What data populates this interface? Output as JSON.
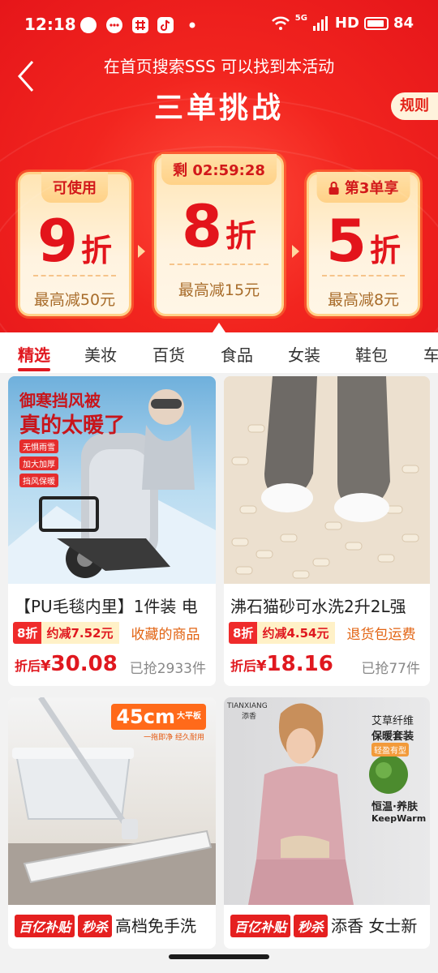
{
  "status": {
    "time": "12:18",
    "network": "5G",
    "hd": "HD",
    "battery": "84"
  },
  "header": {
    "search_hint": "在首页搜索SSS 可以找到本活动",
    "title": "三单挑战",
    "rules_label": "规则"
  },
  "cards": [
    {
      "tag": "可使用",
      "discount": "9",
      "unit": "折",
      "max": "最高减50元"
    },
    {
      "tag": "剩 02:59:28",
      "discount": "8",
      "unit": "折",
      "max": "最高减15元"
    },
    {
      "tag": "第3单享",
      "discount": "5",
      "unit": "折",
      "max": "最高减8元"
    }
  ],
  "tabs": [
    "精选",
    "美妆",
    "百货",
    "食品",
    "女装",
    "鞋包",
    "车"
  ],
  "products": [
    {
      "image_text": {
        "line1": "御寒挡风被",
        "line2": "真的太暖了",
        "chips": [
          "无惧雨雪",
          "加大加厚",
          "挡风保暖"
        ]
      },
      "title": "【PU毛毯内里】1件装 电",
      "badge_discount": "8折",
      "badge_save": "约减7.52元",
      "note": "收藏的商品",
      "price_label": "折后",
      "currency": "¥",
      "price": "30.08",
      "sold": "已抢2933件"
    },
    {
      "title": "沸石猫砂可水洗2升2L强",
      "badge_discount": "8折",
      "badge_save": "约减4.54元",
      "note": "退货包运费",
      "price_label": "折后",
      "currency": "¥",
      "price": "18.16",
      "sold": "已抢77件"
    },
    {
      "image_text": {
        "size": "45cm",
        "size_sub": "大平板",
        "caption": "一拖即净 经久耐用"
      },
      "promo1": "百亿补贴",
      "promo2": "秒杀",
      "title": "高档免手洗"
    },
    {
      "image_text": {
        "brand": "TIANXIANG",
        "brand_cn": "添香",
        "line1": "艾草纤维",
        "line2": "保暖套装",
        "line3": "轻盈有型",
        "line4": "恒温·养肤",
        "line5": "KeepWarm"
      },
      "promo1": "百亿补贴",
      "promo2": "秒杀",
      "title": "添香 女士新"
    }
  ],
  "colors": {
    "accent": "#e0181f",
    "hero": "#f2251f",
    "card_bg": "#fff3e0"
  }
}
